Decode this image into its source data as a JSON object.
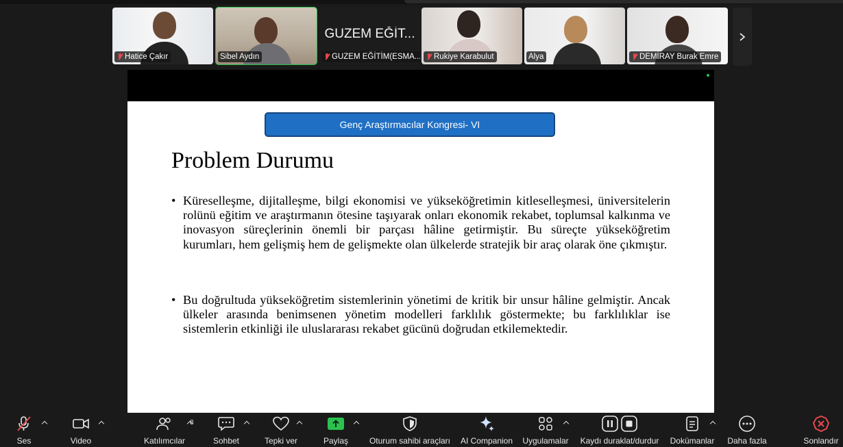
{
  "participants": [
    {
      "name": "Hatice Çakır",
      "muted": true,
      "video": true
    },
    {
      "name": "Sibel Aydın",
      "muted": false,
      "video": true,
      "active_speaker": true
    },
    {
      "name": "GUZEM EĞİTİM(ESMA...",
      "display_title": "GUZEM EĞİT...",
      "muted": true,
      "video": false
    },
    {
      "name": "Rukiye Karabulut",
      "muted": true,
      "video": true
    },
    {
      "name": "Alya",
      "muted": false,
      "video": true
    },
    {
      "name": "DEMİRAY Burak Emre",
      "muted": true,
      "video": true
    }
  ],
  "slide": {
    "banner": "Genç Araştırmacılar Kongresi- VI",
    "title": "Problem Durumu",
    "bullets": [
      "Küreselleşme, dijitalleşme, bilgi ekonomisi ve yükseköğretimin kitleselleşmesi, üniversitelerin rolünü eğitim ve araştırmanın ötesine taşıyarak onları ekonomik rekabet, toplumsal kalkınma ve inovasyon süreçlerinin önemli bir parçası hâline getirmiştir. Bu süreçte yükseköğretim kurumları, hem gelişmiş hem de gelişmekte olan ülkelerde stratejik bir araç olarak öne çıkmıştır.",
      "Bu doğrultuda yükseköğretim sistemlerinin yönetimi de kritik bir unsur hâline gelmiştir. Ancak ülkeler arasında benimsenen yönetim modelleri farklılık göstermekte; bu farklılıklar ise sistemlerin etkinliği ile uluslararası rekabet gücünü doğrudan etkilemektedir."
    ],
    "bullet_glyph": "•"
  },
  "toolbar": {
    "audio": "Ses",
    "video": "Video",
    "participants": "Katılımcılar",
    "participants_count": "8",
    "chat": "Sohbet",
    "reactions": "Tepki ver",
    "share": "Paylaş",
    "host_tools": "Oturum sahibi araçları",
    "ai_companion": "AI Companion",
    "apps": "Uygulamalar",
    "record": "Kaydı duraklat/durdur",
    "docs": "Dokümanlar",
    "more": "Daha fazla",
    "end": "Sonlandır"
  },
  "colors": {
    "active_speaker": "#2bc14f",
    "share_green": "#2bc14f",
    "muted_red": "#e5484d",
    "end_red": "#e5484d",
    "banner_blue": "#1f6fc4"
  },
  "icons": [
    "mic-off-icon",
    "video-icon",
    "participants-icon",
    "chat-icon",
    "heart-icon",
    "share-arrow-icon",
    "shield-icon",
    "sparkle-icon",
    "apps-icon",
    "pause-icon",
    "stop-icon",
    "document-icon",
    "more-icon",
    "end-icon",
    "chevron-right-icon"
  ]
}
